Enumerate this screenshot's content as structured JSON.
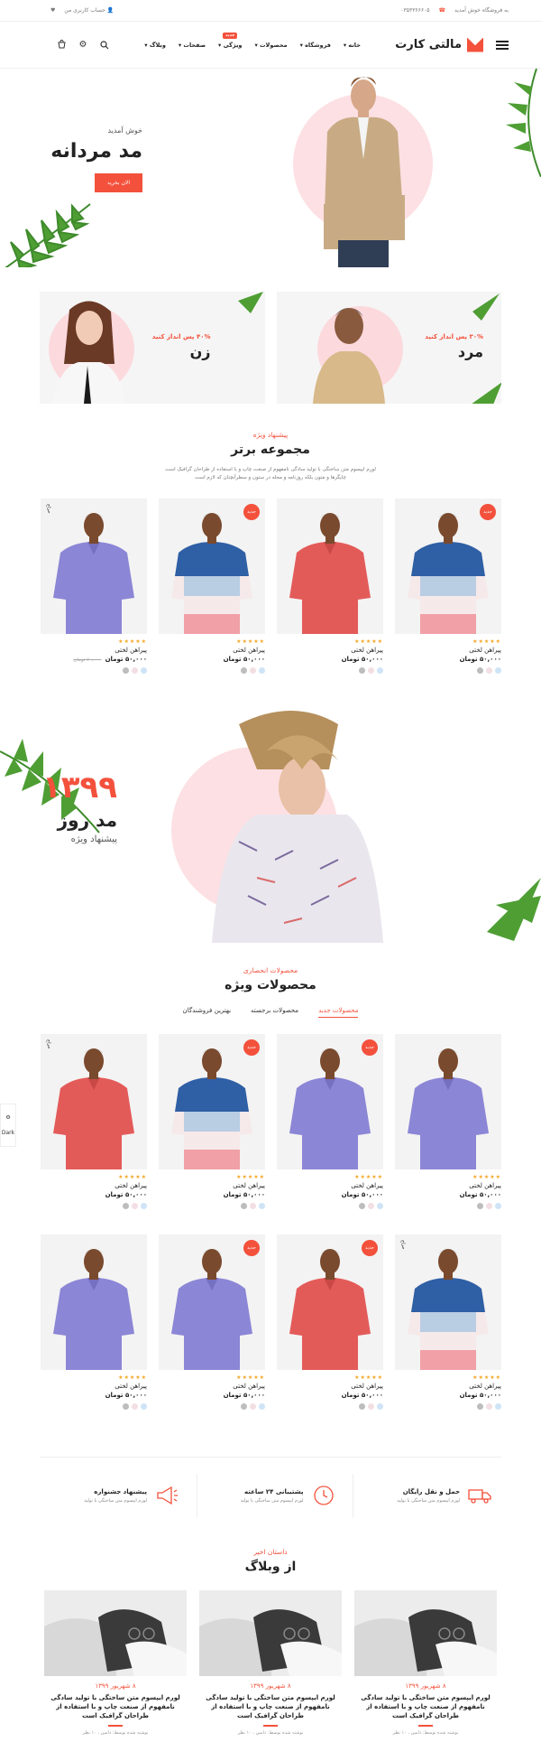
{
  "topbar": {
    "welcome": "به فروشگاه خوش آمدید",
    "phone": "۰۳۵۳۳۶۶۶۰۵",
    "account": "حساب کاربری من"
  },
  "header": {
    "logo": "مالتی کارت",
    "nav": [
      "خانه",
      "فروشگاه",
      "محصولات",
      "ویژگی",
      "صفحات",
      "وبلاگ"
    ],
    "nav_badge": "جدید"
  },
  "hero": {
    "welcome": "خوش آمدید",
    "title": "مد مردانه",
    "button": "الان بخرید"
  },
  "banners": [
    {
      "off": "۳۰% پس انداز کنید",
      "name": "مرد"
    },
    {
      "off": "۴۰% پس انداز کنید",
      "name": "زن"
    }
  ],
  "section1": {
    "sub": "پیشنهاد ویژه",
    "title": "مجموعه برتر",
    "desc": "لورم ایپسوم متن ساختگی با تولید سادگی نامفهوم از صنعت چاپ و با استفاده از طراحان گرافیک است چاپگرها و متون بلکه روزنامه و مجله در ستون و سطرآنچنان که لازم است"
  },
  "product_common": {
    "name": "پیراهن لختی",
    "price": "۵۰,۰۰۰ تومان",
    "old_price": "۷۰,۰۰۰ تومان",
    "stars": "★★★★★",
    "new": "جدید",
    "sale": "حراج"
  },
  "bigbanner": {
    "year": "۱۳۹۹",
    "title": "مد روز",
    "sub": "پیشنهاد ویژه"
  },
  "section2": {
    "sub": "محصولات انحصاری",
    "title": "محصولات ویژه",
    "tabs": [
      "محصولات جدید",
      "محصولات برجسته",
      "بهترین فروشندگان"
    ]
  },
  "features": [
    {
      "title": "حمل و نقل رایگان",
      "desc": "لورم ایپسوم متن ساختگی با تولید"
    },
    {
      "title": "پشتیبانی ۲۴ ساعته",
      "desc": "لورم ایپسوم متن ساختگی با تولید"
    },
    {
      "title": "پیشنهاد جشنواره",
      "desc": "لورم ایپسوم متن ساختگی با تولید"
    }
  ],
  "blog": {
    "sub": "داستان اخیر",
    "title": "از وبلاگ",
    "date": "۸ شهریور ۱۳۹۹",
    "post_title": "لورم ایپسوم متن ساختگی با تولید سادگی نامفهوم از صنعت چاپ و با استفاده از طراحان گرافیک است",
    "author": "نوشته شده توسط: دامین ، ۱۰ نظر"
  },
  "side": {
    "mode": "Dark"
  },
  "colors": {
    "accent": "#f3513c",
    "pink": "#fde0e3"
  }
}
